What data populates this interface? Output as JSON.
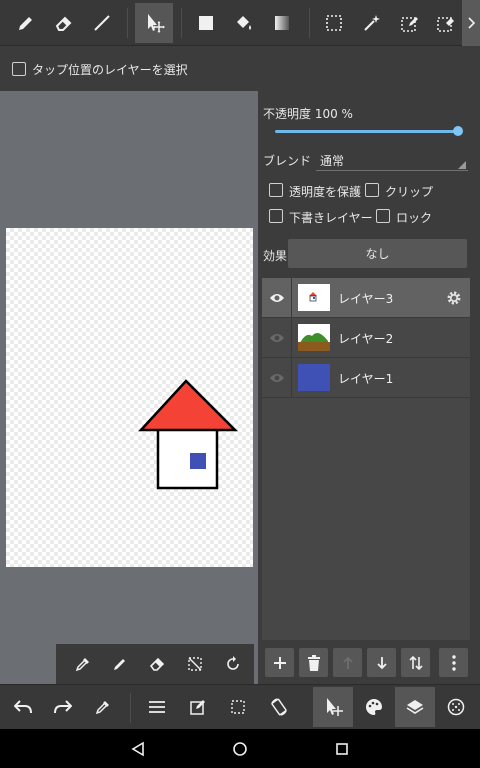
{
  "top_toolbar": {
    "tools": [
      {
        "name": "pen-icon"
      },
      {
        "name": "eraser-icon"
      },
      {
        "name": "line-icon"
      },
      {
        "name": "transform-icon",
        "active": true
      },
      {
        "name": "fill-rect-icon"
      },
      {
        "name": "bucket-icon"
      },
      {
        "name": "gradient-icon"
      },
      {
        "name": "select-rect-icon"
      },
      {
        "name": "magic-wand-icon"
      },
      {
        "name": "select-pen-icon"
      },
      {
        "name": "select-eraser-icon"
      }
    ],
    "more": "chevron-right-icon"
  },
  "option_bar": {
    "select_by_tap_label": "タップ位置のレイヤーを選択",
    "select_by_tap_checked": false
  },
  "layer_panel": {
    "opacity_label": "不透明度 100 %",
    "opacity_value": 1.0,
    "blend_label": "ブレンド",
    "blend_value": "通常",
    "protect_alpha_label": "透明度を保護",
    "clip_label": "クリップ",
    "draft_label": "下書きレイヤー",
    "lock_label": "ロック",
    "effect_label": "効果",
    "effect_value": "なし",
    "layers": [
      {
        "name": "レイヤー3",
        "selected": true,
        "visible": true
      },
      {
        "name": "レイヤー2",
        "selected": false,
        "visible": true
      },
      {
        "name": "レイヤー1",
        "selected": false,
        "visible": true
      }
    ],
    "buttons": [
      "add-layer-button",
      "delete-layer-button",
      "move-up-button",
      "move-down-button",
      "merge-button",
      "more-button"
    ]
  },
  "canvas": {
    "roof_color": "#f44336",
    "window_color": "#3f51b5",
    "layer1_color": "#3f51b5"
  },
  "colors": {
    "accent": "#6fb9ea"
  }
}
